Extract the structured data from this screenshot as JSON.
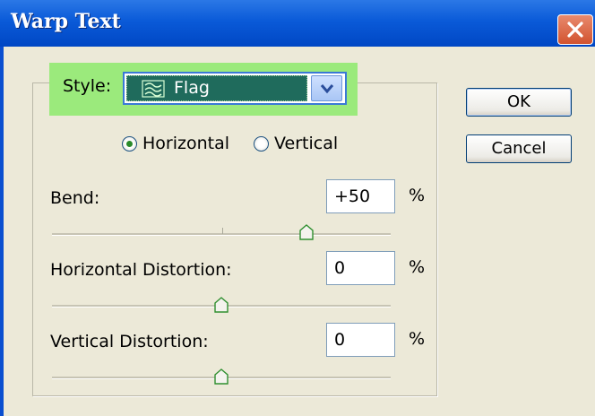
{
  "window": {
    "title": "Warp Text"
  },
  "style": {
    "label": "Style:",
    "value": "Flag"
  },
  "orientation": {
    "horizontal_label": "Horizontal",
    "vertical_label": "Vertical",
    "selected": "Horizontal"
  },
  "bend": {
    "label": "Bend:",
    "value": "+50",
    "unit": "%",
    "slider_value": 50
  },
  "horizontal_distortion": {
    "label": "Horizontal Distortion:",
    "value": "0",
    "unit": "%",
    "slider_value": 0
  },
  "vertical_distortion": {
    "label": "Vertical Distortion:",
    "value": "0",
    "unit": "%",
    "slider_value": 0
  },
  "buttons": {
    "ok": "OK",
    "cancel": "Cancel"
  },
  "colors": {
    "highlight": "#9bea7c",
    "titlebar": "#0a5ad8",
    "selection": "#1f6b5c"
  }
}
